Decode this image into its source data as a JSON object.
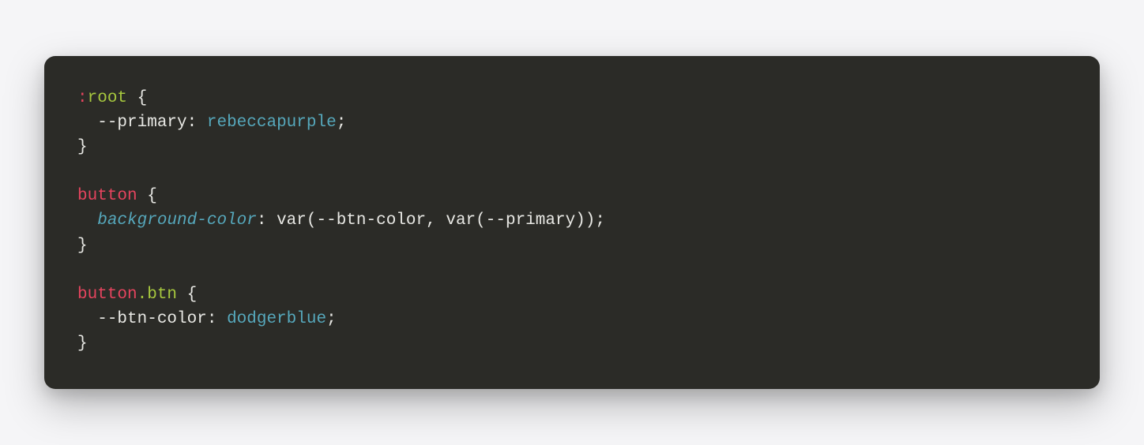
{
  "code": {
    "rules": [
      {
        "selector": {
          "pseudo": ":",
          "name": "root",
          "class": null
        },
        "declarations": [
          {
            "prop": "--primary",
            "propStyle": "var-name",
            "value": "rebeccapurple"
          }
        ]
      },
      {
        "selector": {
          "pseudo": null,
          "name": "button",
          "class": null
        },
        "declarations": [
          {
            "prop": "background-color",
            "propStyle": "prop-ital",
            "fn": "var",
            "args": [
              "--btn-color",
              {
                "fn": "var",
                "args": [
                  "--primary"
                ]
              }
            ]
          }
        ]
      },
      {
        "selector": {
          "pseudo": null,
          "name": "button",
          "class": ".btn"
        },
        "declarations": [
          {
            "prop": "--btn-color",
            "propStyle": "var-name",
            "value": "dodgerblue"
          }
        ]
      }
    ]
  },
  "colors": {
    "bg": "#2b2b27",
    "page": "#f5f5f7",
    "text": "#e8e8e4",
    "selector": "#e5445e",
    "class": "#a6c73e",
    "keyword": "#56a8bc"
  }
}
